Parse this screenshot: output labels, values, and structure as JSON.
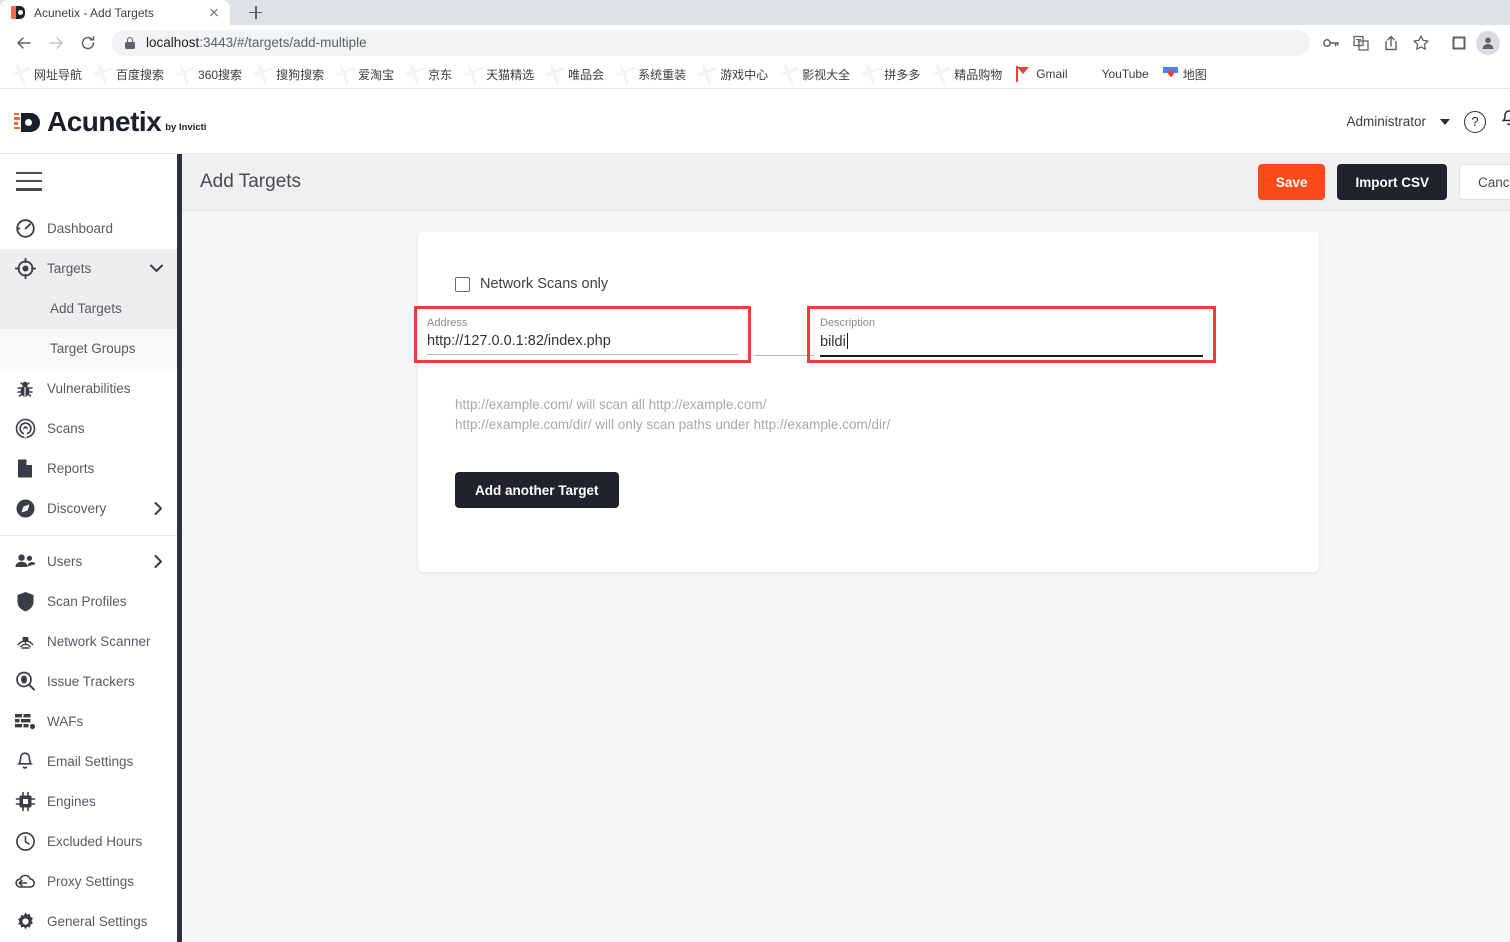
{
  "browser": {
    "tab": {
      "title": "Acunetix - Add Targets",
      "favicon": "acunetix-favicon",
      "close": "×"
    },
    "newtab_label": "+",
    "omnibox": {
      "url_host": "localhost",
      "url_rest": ":3443/#/targets/add-multiple",
      "lock": "lock-icon"
    },
    "nav": {
      "back": "back-arrow",
      "forward": "forward-arrow",
      "reload": "reload-icon"
    },
    "toolbar_icons": [
      "key-icon",
      "translate-icon",
      "share-icon",
      "bookmark-star-icon",
      "collections-icon",
      "profile-avatar-icon"
    ],
    "bookmarks": [
      {
        "label": "网址导航",
        "icon": "globe-icon"
      },
      {
        "label": "百度搜索",
        "icon": "globe-icon"
      },
      {
        "label": "360搜索",
        "icon": "globe-icon"
      },
      {
        "label": "搜狗搜索",
        "icon": "globe-icon"
      },
      {
        "label": "爱淘宝",
        "icon": "globe-icon"
      },
      {
        "label": "京东",
        "icon": "globe-icon"
      },
      {
        "label": "天猫精选",
        "icon": "globe-icon"
      },
      {
        "label": "唯品会",
        "icon": "globe-icon"
      },
      {
        "label": "系统重装",
        "icon": "globe-icon"
      },
      {
        "label": "游戏中心",
        "icon": "globe-icon"
      },
      {
        "label": "影视大全",
        "icon": "globe-icon"
      },
      {
        "label": "拼多多",
        "icon": "globe-icon"
      },
      {
        "label": "精品购物",
        "icon": "globe-icon"
      },
      {
        "label": "Gmail",
        "icon": "gmail-icon"
      },
      {
        "label": "YouTube",
        "icon": "youtube-icon"
      },
      {
        "label": "地图",
        "icon": "maps-icon"
      }
    ]
  },
  "app": {
    "logo": {
      "name": "Acunetix",
      "tagline": "by Invicti"
    },
    "header": {
      "user": "Administrator",
      "help": "?"
    },
    "sidebar": {
      "items": [
        {
          "label": "Dashboard",
          "icon": "dashboard-icon",
          "state": "normal"
        },
        {
          "label": "Targets",
          "icon": "target-icon",
          "state": "active",
          "chevron": "chevron-down-icon"
        },
        {
          "label": "Add Targets",
          "icon": "",
          "state": "sub-active"
        },
        {
          "label": "Target Groups",
          "icon": "",
          "state": "sub-alt"
        },
        {
          "label": "Vulnerabilities",
          "icon": "bug-icon",
          "state": "normal"
        },
        {
          "label": "Scans",
          "icon": "scan-icon",
          "state": "normal"
        },
        {
          "label": "Reports",
          "icon": "report-icon",
          "state": "normal"
        },
        {
          "label": "Discovery",
          "icon": "compass-icon",
          "state": "normal",
          "chevron": "chevron-right-icon"
        },
        {
          "label": "Users",
          "icon": "users-icon",
          "state": "normal",
          "chevron": "chevron-right-icon"
        },
        {
          "label": "Scan Profiles",
          "icon": "shield-icon",
          "state": "normal"
        },
        {
          "label": "Network Scanner",
          "icon": "network-scanner-icon",
          "state": "normal"
        },
        {
          "label": "Issue Trackers",
          "icon": "issue-tracker-icon",
          "state": "normal"
        },
        {
          "label": "WAFs",
          "icon": "waf-icon",
          "state": "normal"
        },
        {
          "label": "Email Settings",
          "icon": "bell-icon",
          "state": "normal"
        },
        {
          "label": "Engines",
          "icon": "chip-icon",
          "state": "normal"
        },
        {
          "label": "Excluded Hours",
          "icon": "clock-icon",
          "state": "normal"
        },
        {
          "label": "Proxy Settings",
          "icon": "proxy-cloud-icon",
          "state": "normal"
        },
        {
          "label": "General Settings",
          "icon": "gear-icon",
          "state": "normal"
        }
      ]
    },
    "main": {
      "page_title": "Add Targets",
      "actions": {
        "save": "Save",
        "import_csv": "Import CSV",
        "cancel": "Cance"
      },
      "form": {
        "network_scans_only_label": "Network Scans only",
        "network_scans_only_checked": false,
        "address": {
          "label": "Address",
          "value": "http://127.0.0.1:82/index.php",
          "highlighted": true
        },
        "description": {
          "label": "Description",
          "value": "bildi",
          "highlighted": true,
          "focused": true
        },
        "hint_line_1": "http://example.com/ will scan all http://example.com/",
        "hint_line_2": "http://example.com/dir/ will only scan paths under http://example.com/dir/",
        "add_another_label": "Add another Target"
      }
    }
  },
  "colors": {
    "accent_orange": "#fc4a1a",
    "dark": "#20232e",
    "highlight_red": "#ef3b39",
    "content_bg": "#f7f7f7"
  }
}
